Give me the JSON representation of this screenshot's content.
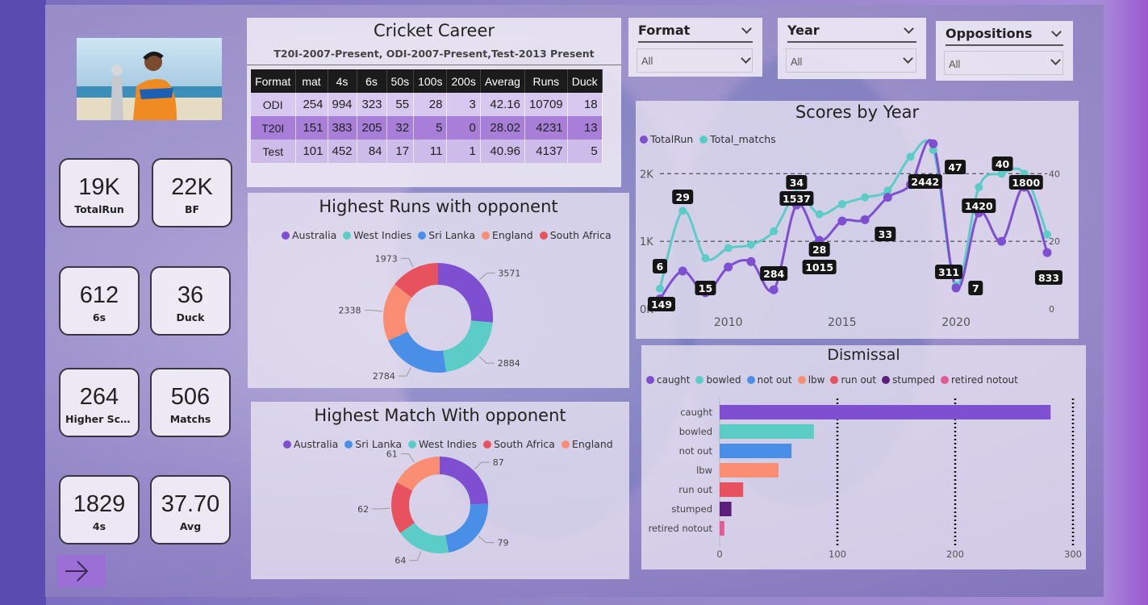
{
  "colors": {
    "purple": "#7e4fd0",
    "teal": "#5bcdc6",
    "blue": "#4a8fe7",
    "salmon": "#fa8d72",
    "red": "#e8525e",
    "darkpurple": "#5b1e7a",
    "pink": "#e25a96"
  },
  "kpis": [
    {
      "value": "19K",
      "label": "TotalRun"
    },
    {
      "value": "22K",
      "label": "BF"
    },
    {
      "value": "612",
      "label": "6s"
    },
    {
      "value": "36",
      "label": "Duck"
    },
    {
      "value": "264",
      "label": "Higher Score"
    },
    {
      "value": "506",
      "label": "Matchs"
    },
    {
      "value": "1829",
      "label": "4s"
    },
    {
      "value": "37.70",
      "label": "Avg"
    }
  ],
  "career": {
    "title": "Cricket Career",
    "subtitle": "T20I-2007-Present, ODI-2007-Present,Test-2013 Present",
    "columns": [
      "Format",
      "mat",
      "4s",
      "6s",
      "50s",
      "100s",
      "200s",
      "Averag",
      "Runs",
      "Duck"
    ],
    "rows": [
      [
        "ODI",
        "254",
        "994",
        "323",
        "55",
        "28",
        "3",
        "42.16",
        "10709",
        "18"
      ],
      [
        "T20I",
        "151",
        "383",
        "205",
        "32",
        "5",
        "0",
        "28.02",
        "4231",
        "13"
      ],
      [
        "Test",
        "101",
        "452",
        "84",
        "17",
        "11",
        "1",
        "40.96",
        "4137",
        "5"
      ]
    ]
  },
  "slicers": [
    {
      "title": "Format",
      "value": "All"
    },
    {
      "title": "Year",
      "value": "All"
    },
    {
      "title": "Oppositions",
      "value": "All"
    }
  ],
  "runs_donut": {
    "title": "Highest Runs with opponent",
    "legend": [
      "Australia",
      "West Indies",
      "Sri Lanka",
      "England",
      "South Africa"
    ],
    "labels": [
      "3571",
      "2884",
      "2784",
      "2338",
      "1973"
    ]
  },
  "match_donut": {
    "title": "Highest Match With opponent",
    "legend": [
      "Australia",
      "Sri Lanka",
      "West Indies",
      "South Africa",
      "England"
    ],
    "labels": [
      "87",
      "79",
      "64",
      "62",
      "61"
    ]
  },
  "scores_chart": {
    "title": "Scores by Year",
    "legend": [
      "TotalRun",
      "Total_matchs"
    ],
    "x_ticks": [
      "2010",
      "2015",
      "2020"
    ],
    "y_left_ticks": [
      "0K",
      "1K",
      "2K"
    ],
    "y_right_ticks": [
      "0",
      "20",
      "40"
    ],
    "run_labels": [
      "149",
      "1537",
      "1015",
      "284",
      "2442",
      "311",
      "1420",
      "1800",
      "833"
    ],
    "match_labels": [
      "6",
      "29",
      "15",
      "34",
      "28",
      "33",
      "47",
      "7",
      "40"
    ]
  },
  "dismissal": {
    "title": "Dismissal",
    "legend": [
      "caught",
      "bowled",
      "not out",
      "lbw",
      "run out",
      "stumped",
      "retired notout"
    ],
    "x_ticks": [
      "0",
      "100",
      "200",
      "300"
    ]
  },
  "chart_data": [
    {
      "type": "pie",
      "title": "Highest Runs with opponent",
      "categories": [
        "Australia",
        "West Indies",
        "Sri Lanka",
        "England",
        "South Africa"
      ],
      "values": [
        3571,
        2884,
        2784,
        2338,
        1973
      ]
    },
    {
      "type": "pie",
      "title": "Highest Match With opponent",
      "categories": [
        "Australia",
        "Sri Lanka",
        "West Indies",
        "South Africa",
        "England"
      ],
      "values": [
        87,
        79,
        64,
        62,
        61
      ]
    },
    {
      "type": "line",
      "title": "Scores by Year",
      "x": [
        2007,
        2008,
        2009,
        2010,
        2011,
        2012,
        2013,
        2014,
        2015,
        2016,
        2017,
        2018,
        2019,
        2020,
        2021,
        2022,
        2023,
        2024
      ],
      "series": [
        {
          "name": "TotalRun",
          "values": [
            149,
            560,
            240,
            620,
            700,
            284,
            1537,
            1015,
            1300,
            1320,
            1650,
            1840,
            2442,
            311,
            1420,
            1000,
            1800,
            833
          ]
        },
        {
          "name": "Total_matchs",
          "values": [
            6,
            29,
            15,
            18,
            19,
            23,
            34,
            28,
            31,
            33,
            35,
            45,
            47,
            7,
            36,
            40,
            40,
            22
          ]
        }
      ],
      "ylim": [
        0,
        2600
      ],
      "y2lim": [
        0,
        52
      ]
    },
    {
      "type": "bar",
      "title": "Dismissal",
      "categories": [
        "caught",
        "bowled",
        "not out",
        "lbw",
        "run out",
        "stumped",
        "retired notout"
      ],
      "values": [
        281,
        80,
        61,
        50,
        20,
        10,
        4
      ],
      "xlim": [
        0,
        300
      ]
    }
  ]
}
